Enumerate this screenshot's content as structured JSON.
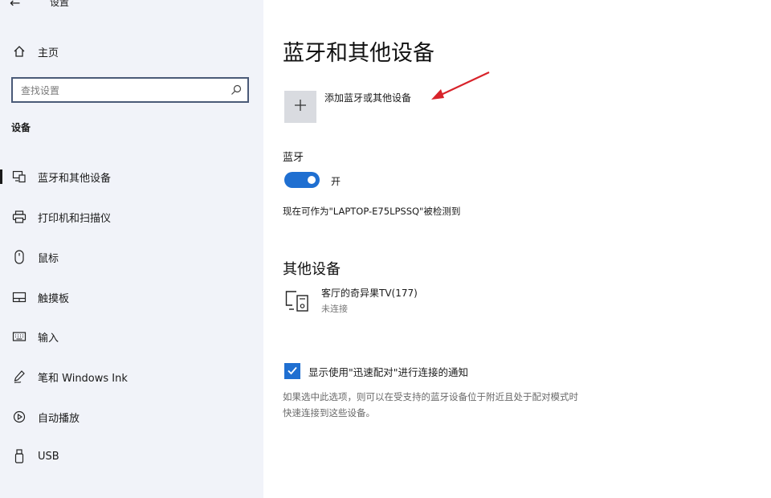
{
  "window": {
    "back_glyph": "←",
    "title": "设置"
  },
  "sidebar": {
    "home_label": "主页",
    "search_placeholder": "查找设置",
    "section_title": "设备",
    "items": [
      {
        "label": "蓝牙和其他设备",
        "icon": "bluetooth-devices-icon",
        "selected": true
      },
      {
        "label": "打印机和扫描仪",
        "icon": "printer-icon"
      },
      {
        "label": "鼠标",
        "icon": "mouse-icon"
      },
      {
        "label": "触摸板",
        "icon": "touchpad-icon"
      },
      {
        "label": "输入",
        "icon": "keyboard-icon"
      },
      {
        "label": "笔和 Windows Ink",
        "icon": "pen-icon"
      },
      {
        "label": "自动播放",
        "icon": "autoplay-icon"
      },
      {
        "label": "USB",
        "icon": "usb-icon"
      }
    ]
  },
  "main": {
    "title": "蓝牙和其他设备",
    "add_device_label": "添加蓝牙或其他设备",
    "bluetooth": {
      "label": "蓝牙",
      "state_label": "开",
      "enabled": true,
      "discoverable_text": "现在可作为\"LAPTOP-E75LPSSQ\"被检测到"
    },
    "other_devices": {
      "title": "其他设备",
      "devices": [
        {
          "name": "客厅的奇异果TV(177)",
          "status": "未连接",
          "icon": "display-device-icon"
        }
      ]
    },
    "swift_pair": {
      "checked": true,
      "label": "显示使用\"迅速配对\"进行连接的通知",
      "description_line1": "如果选中此选项，则可以在受支持的蓝牙设备位于附近且处于配对模式时",
      "description_line2": "快速连接到这些设备。"
    }
  },
  "colors": {
    "accent": "#1f6fd1",
    "sidebar_bg": "#f1f3f9",
    "annotation_arrow": "#d8232a"
  }
}
